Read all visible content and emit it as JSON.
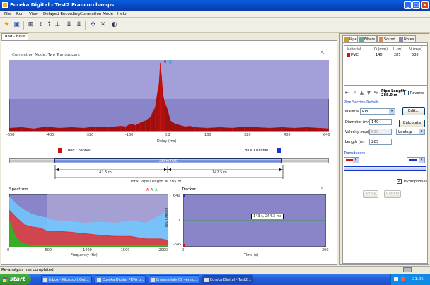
{
  "window": {
    "title": "Eureka Digital - Test2 Francorchamps"
  },
  "menu": [
    "File",
    "Run",
    "View",
    "Delayed Recording",
    "Correlation Mode",
    "Help"
  ],
  "tabs": {
    "main": "Red - Blue"
  },
  "correlation": {
    "title": "Correlation Mode: Two Transducers",
    "marker": "0",
    "xlabel": "Delay (ms)",
    "xticks": [
      "-650",
      "-480",
      "-320",
      "-160",
      "0.2",
      "160",
      "320",
      "480",
      "640"
    ]
  },
  "channels": {
    "red": "Red Channel",
    "blue": "Blue Channel"
  },
  "pipe_diagram": {
    "segment_label": "285m PVC",
    "left_dist": "142.5 m",
    "right_dist": "142.5 m",
    "total": "Total Pipe Length = 285 m"
  },
  "spectrum": {
    "title": "Spectrum",
    "xlabel": "Frequency (Hz)",
    "xticks": [
      "0",
      "500",
      "1000",
      "1500",
      "2000"
    ]
  },
  "tracker": {
    "title": "Tracker",
    "ylabel": "Delay (ms)",
    "yticks": [
      "640",
      "0",
      "-645"
    ],
    "xlabel": "Time (s)",
    "xticks": [
      "0",
      "300"
    ],
    "tooltip": "143 s, 264.3 ms"
  },
  "chart_data": [
    {
      "type": "bar",
      "title": "Correlation Mode: Two Transducers",
      "xlabel": "Delay (ms)",
      "xlim": [
        -650,
        640
      ],
      "x": [
        -650,
        -600,
        -550,
        -500,
        -450,
        -400,
        -350,
        -300,
        -250,
        -200,
        -180,
        -160,
        -140,
        -120,
        -100,
        -80,
        -70,
        -60,
        -50,
        -45,
        -40,
        -35,
        -30,
        -25,
        -20,
        -10,
        0,
        20,
        40,
        60,
        80,
        100,
        150,
        200,
        250,
        300,
        350,
        400,
        450,
        500,
        550,
        600,
        640
      ],
      "values": [
        0.04,
        0.05,
        0.03,
        0.06,
        0.04,
        0.05,
        0.04,
        0.06,
        0.05,
        0.07,
        0.06,
        0.1,
        0.08,
        0.12,
        0.15,
        0.2,
        0.28,
        0.35,
        0.6,
        0.7,
        1.0,
        0.8,
        0.55,
        0.45,
        0.4,
        0.3,
        0.15,
        0.1,
        0.08,
        0.06,
        0.07,
        0.05,
        0.04,
        0.05,
        0.04,
        0.06,
        0.05,
        0.04,
        0.05,
        0.04,
        0.05,
        0.04,
        0.03
      ]
    },
    {
      "type": "area",
      "title": "Spectrum",
      "xlabel": "Frequency (Hz)",
      "xlim": [
        0,
        2100
      ],
      "ylim": [
        0,
        1
      ],
      "series": [
        {
          "color": "#6fc8ff",
          "x": [
            0,
            100,
            200,
            300,
            400,
            500,
            600,
            800,
            1000,
            1200,
            1400,
            1600,
            1800,
            2000,
            2100
          ],
          "values": [
            0.95,
            0.8,
            0.7,
            0.62,
            0.58,
            0.55,
            0.5,
            0.48,
            0.45,
            0.47,
            0.45,
            0.5,
            0.45,
            0.6,
            0.7
          ]
        },
        {
          "color": "#e03030",
          "x": [
            0,
            100,
            200,
            300,
            400,
            500,
            600,
            800,
            1000,
            1200,
            1400,
            1600,
            1800,
            2000,
            2100
          ],
          "values": [
            0.7,
            0.55,
            0.42,
            0.38,
            0.36,
            0.3,
            0.3,
            0.28,
            0.25,
            0.22,
            0.2,
            0.2,
            0.15,
            0.15,
            0.12
          ]
        },
        {
          "color": "#20c020",
          "x": [
            0,
            50,
            100,
            150,
            200,
            300,
            500,
            1000,
            2100
          ],
          "values": [
            0.5,
            0.3,
            0.15,
            0.08,
            0.05,
            0.03,
            0.02,
            0.02,
            0.02
          ]
        }
      ]
    },
    {
      "type": "line",
      "title": "Tracker",
      "xlabel": "Time (s)",
      "ylabel": "Delay (ms)",
      "xlim": [
        0,
        300
      ],
      "ylim": [
        -645,
        640
      ],
      "series": [
        {
          "color": "#20a020",
          "x": [
            0,
            300
          ],
          "values": [
            -5,
            -5
          ]
        }
      ]
    }
  ],
  "side": {
    "tabs": [
      "Pipe",
      "Filters",
      "Sound",
      "Notes"
    ],
    "table": {
      "headers": [
        "Material",
        "D (mm)",
        "L (m)",
        "V (m/s)"
      ],
      "rows": [
        [
          "PVC",
          "140",
          "285",
          "530"
        ]
      ]
    },
    "pipe_length": "Pipe Length:\n285.0 m",
    "reverse_label": "Reverse",
    "section_heading": "Pipe Section Details",
    "material_label": "Material",
    "material_value": "PVC",
    "edit_label": "Edit...",
    "diameter_label": "Diameter (mm)",
    "diameter_value": "140",
    "velocity_label": "Velocity (m/s)",
    "velocity_value": "530",
    "length_label": "Length (m)",
    "length_value": "285",
    "calculate_label": "Calculate",
    "lookup_value": "Lookup",
    "transducers_heading": "Transducers",
    "hydrophones_label": "Hydrophones",
    "apply_label": "Apply",
    "cancel_label": "Cancel"
  },
  "status": {
    "text": "Re-analysis has completed"
  },
  "taskbar": {
    "start": "start",
    "tasks": [
      "Inbox - Microsoft Out...",
      "Eureka Digital PRVA o...",
      "Enigma July 09 versio...",
      "Eureka Digital - Test2..."
    ],
    "clock": "21:05"
  },
  "colors": {
    "red": "#cc1111",
    "blue": "#1a34c8",
    "plot_bg": "#8a84c8"
  }
}
